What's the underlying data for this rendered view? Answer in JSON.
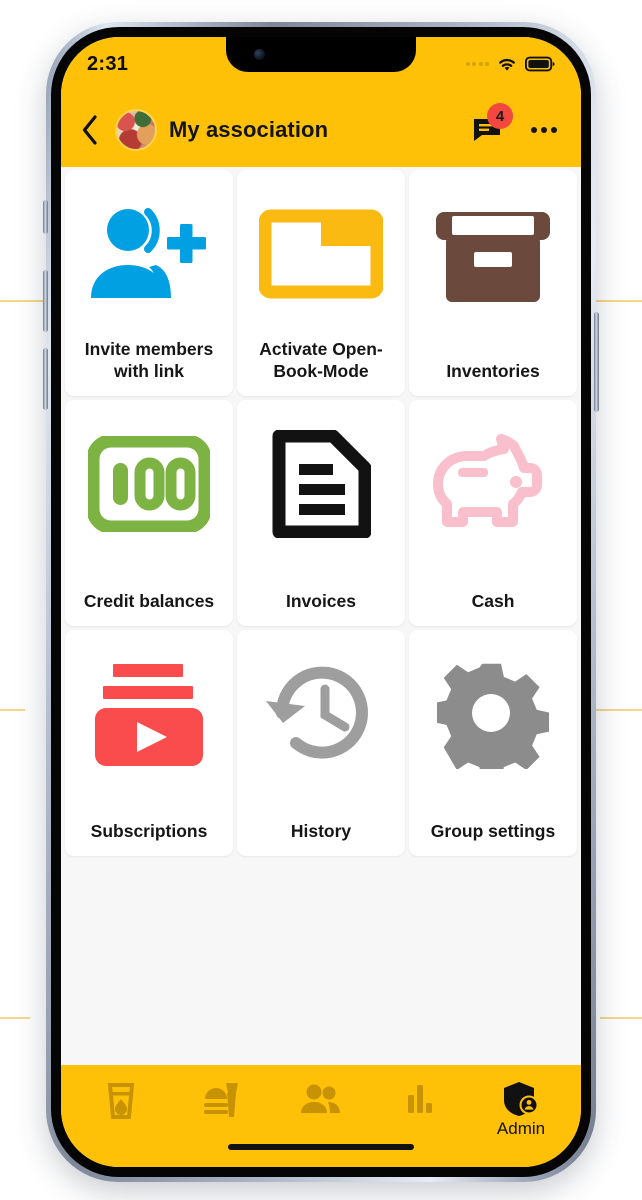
{
  "theme": {
    "brand_yellow": "#FFC107",
    "page_bg": "#F7F7F8",
    "badge_red": "#F4473F",
    "invite_blue": "#00A0E3",
    "folder_yellow": "#FBBA12",
    "inventory_brown": "#6B4A3D",
    "credit_green": "#7CB342",
    "invoice_black": "#121212",
    "cash_pink": "#F9BFCC",
    "subscriptions_red": "#FA4C4C",
    "history_gray": "#9E9E9E",
    "settings_gray": "#8C8C8C",
    "nav_inactive": "#C79304",
    "nav_active": "#111111"
  },
  "status_bar": {
    "time": "2:31",
    "signal_icon": "signal-dots-icon",
    "wifi_icon": "wifi-icon",
    "battery_icon": "battery-full-icon"
  },
  "app_bar": {
    "back_icon": "chevron-left-icon",
    "avatar_icon": "group-avatar-photo",
    "title": "My association",
    "chat_icon": "chat-bubble-icon",
    "chat_badge_count": "4",
    "overflow_icon": "overflow-menu-icon"
  },
  "grid": {
    "tiles": [
      {
        "label": "Invite members with link",
        "icon": "person-add-icon"
      },
      {
        "label": "Activate Open-Book-Mode",
        "icon": "open-folder-icon"
      },
      {
        "label": "Inventories",
        "icon": "archive-box-icon"
      },
      {
        "label": "Credit balances",
        "icon": "banknote-100-icon"
      },
      {
        "label": "Invoices",
        "icon": "document-lines-icon"
      },
      {
        "label": "Cash",
        "icon": "piggy-bank-icon"
      },
      {
        "label": "Subscriptions",
        "icon": "subscriptions-play-icon"
      },
      {
        "label": "History",
        "icon": "history-clock-icon"
      },
      {
        "label": "Group settings",
        "icon": "gear-icon"
      }
    ]
  },
  "bottom_nav": {
    "items": [
      {
        "label": "",
        "icon": "drink-glass-icon",
        "active": false
      },
      {
        "label": "",
        "icon": "fast-food-icon",
        "active": false
      },
      {
        "label": "",
        "icon": "people-icon",
        "active": false
      },
      {
        "label": "",
        "icon": "bar-chart-icon",
        "active": false
      },
      {
        "label": "Admin",
        "icon": "shield-person-icon",
        "active": true
      }
    ]
  },
  "system": {
    "home_indicator": "home-indicator-bar",
    "notch": "notch",
    "camera": "front-camera-lens"
  }
}
